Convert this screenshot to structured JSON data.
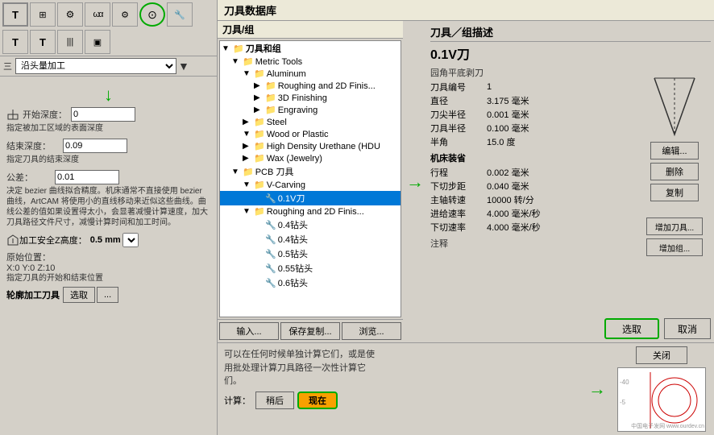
{
  "leftPanel": {
    "toolbar": {
      "buttons": [
        "T",
        "⊞",
        "🔧",
        "∫",
        "⚙",
        "T",
        "|||",
        "▣"
      ],
      "comboLabel": "沿头量加工",
      "comboOptions": [
        "沿头量加工"
      ]
    },
    "sections": [
      {
        "id": "start-depth",
        "icon": "⊥",
        "label": "开始深度：",
        "value": "0",
        "desc": "指定被加工区域的表面深度"
      },
      {
        "id": "end-depth",
        "label": "结束深度：",
        "value": "0.09",
        "desc": "指定刀具的结束深度"
      },
      {
        "id": "tolerance",
        "label": "公差：",
        "value": "0.01",
        "desc": "决定 bezier 曲线拟合精度。机床通常不直接使用 bezier 曲线，ArtCAM 将使用小的直线移动来近似这些曲线。曲线公差的值如果设置得太小，会显著减慢计算速度，加大刀具路径文件尺寸，减慢计算时间和加工时间。"
      }
    ],
    "safeHeight": {
      "label": "加工安全Z高度：",
      "value": "0.5 mm"
    },
    "origin": {
      "label": "原始位置：",
      "value": "X:0 Y:0 Z:10"
    },
    "originDesc": "指定刀具的开始和结束位置",
    "contour": {
      "label": "轮廓加工刀具",
      "btn1": "选取",
      "btn2": "..."
    }
  },
  "toolDB": {
    "title": "刀具数据库",
    "treeTitle": "刀具/组",
    "detailTitle": "刀具／组描述",
    "toolName": "0.1V刀",
    "toolType": "园角平底剥刀",
    "tree": [
      {
        "level": 0,
        "expand": "▼",
        "icon": "📁",
        "label": "刀具和组",
        "bold": true
      },
      {
        "level": 1,
        "expand": "▼",
        "icon": "📁",
        "label": "Metric Tools",
        "bold": false
      },
      {
        "level": 2,
        "expand": "▼",
        "icon": "📁",
        "label": "Aluminum",
        "bold": false
      },
      {
        "level": 3,
        "expand": "▶",
        "icon": "📄",
        "label": "Roughing and 2D Finis...",
        "bold": false
      },
      {
        "level": 3,
        "expand": "▶",
        "icon": "📄",
        "label": "3D Finishing",
        "bold": false
      },
      {
        "level": 3,
        "expand": "▶",
        "icon": "📄",
        "label": "Engraving",
        "bold": false
      },
      {
        "level": 2,
        "expand": "▶",
        "icon": "📁",
        "label": "Steel",
        "bold": false
      },
      {
        "level": 2,
        "expand": "▼",
        "icon": "📁",
        "label": "Wood or Plastic",
        "bold": false
      },
      {
        "level": 2,
        "expand": "▶",
        "icon": "📁",
        "label": "High Density Urethane (HDU",
        "bold": false
      },
      {
        "level": 2,
        "expand": "▶",
        "icon": "📁",
        "label": "Wax (Jewelry)",
        "bold": false
      },
      {
        "level": 1,
        "expand": "▼",
        "icon": "📁",
        "label": "PCB 刀具",
        "bold": false
      },
      {
        "level": 2,
        "expand": "▼",
        "icon": "📁",
        "label": "V-Carving",
        "bold": false
      },
      {
        "level": 3,
        "expand": "",
        "icon": "🔧",
        "label": "0.1V刀",
        "selected": true,
        "bold": false
      },
      {
        "level": 2,
        "expand": "▼",
        "icon": "📁",
        "label": "Roughing and 2D Finis...",
        "bold": false
      },
      {
        "level": 3,
        "expand": "",
        "icon": "🔧",
        "label": "0.4钻头",
        "bold": false
      },
      {
        "level": 3,
        "expand": "",
        "icon": "🔧",
        "label": "0.4钻头",
        "bold": false
      },
      {
        "level": 3,
        "expand": "",
        "icon": "🔧",
        "label": "0.5钻头",
        "bold": false
      },
      {
        "level": 3,
        "expand": "",
        "icon": "🔧",
        "label": "0.55钻头",
        "bold": false
      },
      {
        "level": 3,
        "expand": "",
        "icon": "🔧",
        "label": "0.6钻头",
        "bold": false
      }
    ],
    "toolDetails": {
      "toolNumber": "1",
      "diameter": "3.175 毫米",
      "tipRadius": "0.001 毫米",
      "halfDiam": "0.100 毫米",
      "halfAngle": "15.0 度",
      "machineOffset": "",
      "passDepth": "0.002 毫米",
      "stepDown": "0.040 毫米",
      "spindleSpeed": "10000 转/分",
      "feedRate": "4.000 毫米/秒",
      "plungeRate": "4.000 毫米/秒",
      "note": ""
    },
    "actionBtns": [
      "编辑...",
      "删除",
      "复制"
    ],
    "addBtns": [
      "增加刀具...",
      "增加组..."
    ],
    "bottomBtns": [
      "输入...",
      "保存复制...",
      "浏览..."
    ],
    "selectBtn": "选取",
    "cancelBtn": "取消"
  },
  "bottomPanel": {
    "text1": "可以在任何时候单独计算它们，或是使",
    "text2": "用批处理计算刀具路径一次性计算它",
    "text3": "们。",
    "calcLabel": "计算：",
    "laterBtn": "稍后",
    "nowBtn": "现在",
    "closeBtn": "关闭"
  },
  "icons": {
    "greenArrowDown": "↓",
    "greenArrowRight": "→",
    "greenCircle": "○"
  }
}
